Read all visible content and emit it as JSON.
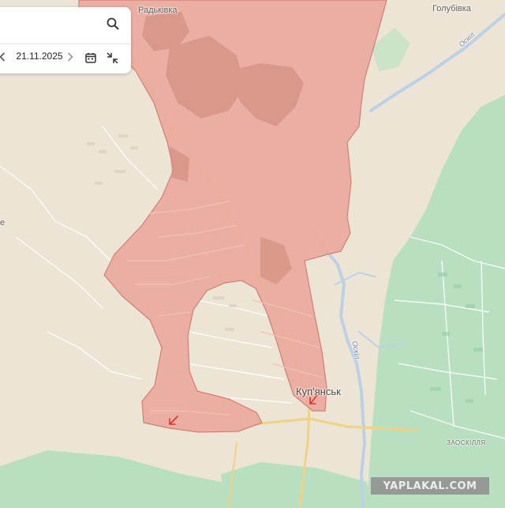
{
  "labels": {
    "radkivka": "Радьківка",
    "holubivka": "Голубівка",
    "kupiansk": "Куп'янськ",
    "zaoskillia": "ЗАОСКІЛЛЯ",
    "oskil_north": "Оскіл",
    "oskil_south": "Оскіл",
    "left_edge": "е"
  },
  "controls": {
    "date": "21.11.2025"
  },
  "icons": {
    "search": "search-icon",
    "prev": "chevron-left-icon",
    "next": "chevron-right-icon",
    "calendar": "calendar-icon",
    "compare": "compress-arrows-icon",
    "marker": "attack-arrow-icon"
  },
  "watermark": "YAPLAKAL.COM",
  "colors": {
    "land": "#ece5d6",
    "forest": "#b5dfbf",
    "occupied": "#eaa99e",
    "occupied_border": "#d37e73",
    "river": "#b8cfe6",
    "road": "#f2d182",
    "street": "#ffffff",
    "attack_marker": "#d9342b"
  }
}
